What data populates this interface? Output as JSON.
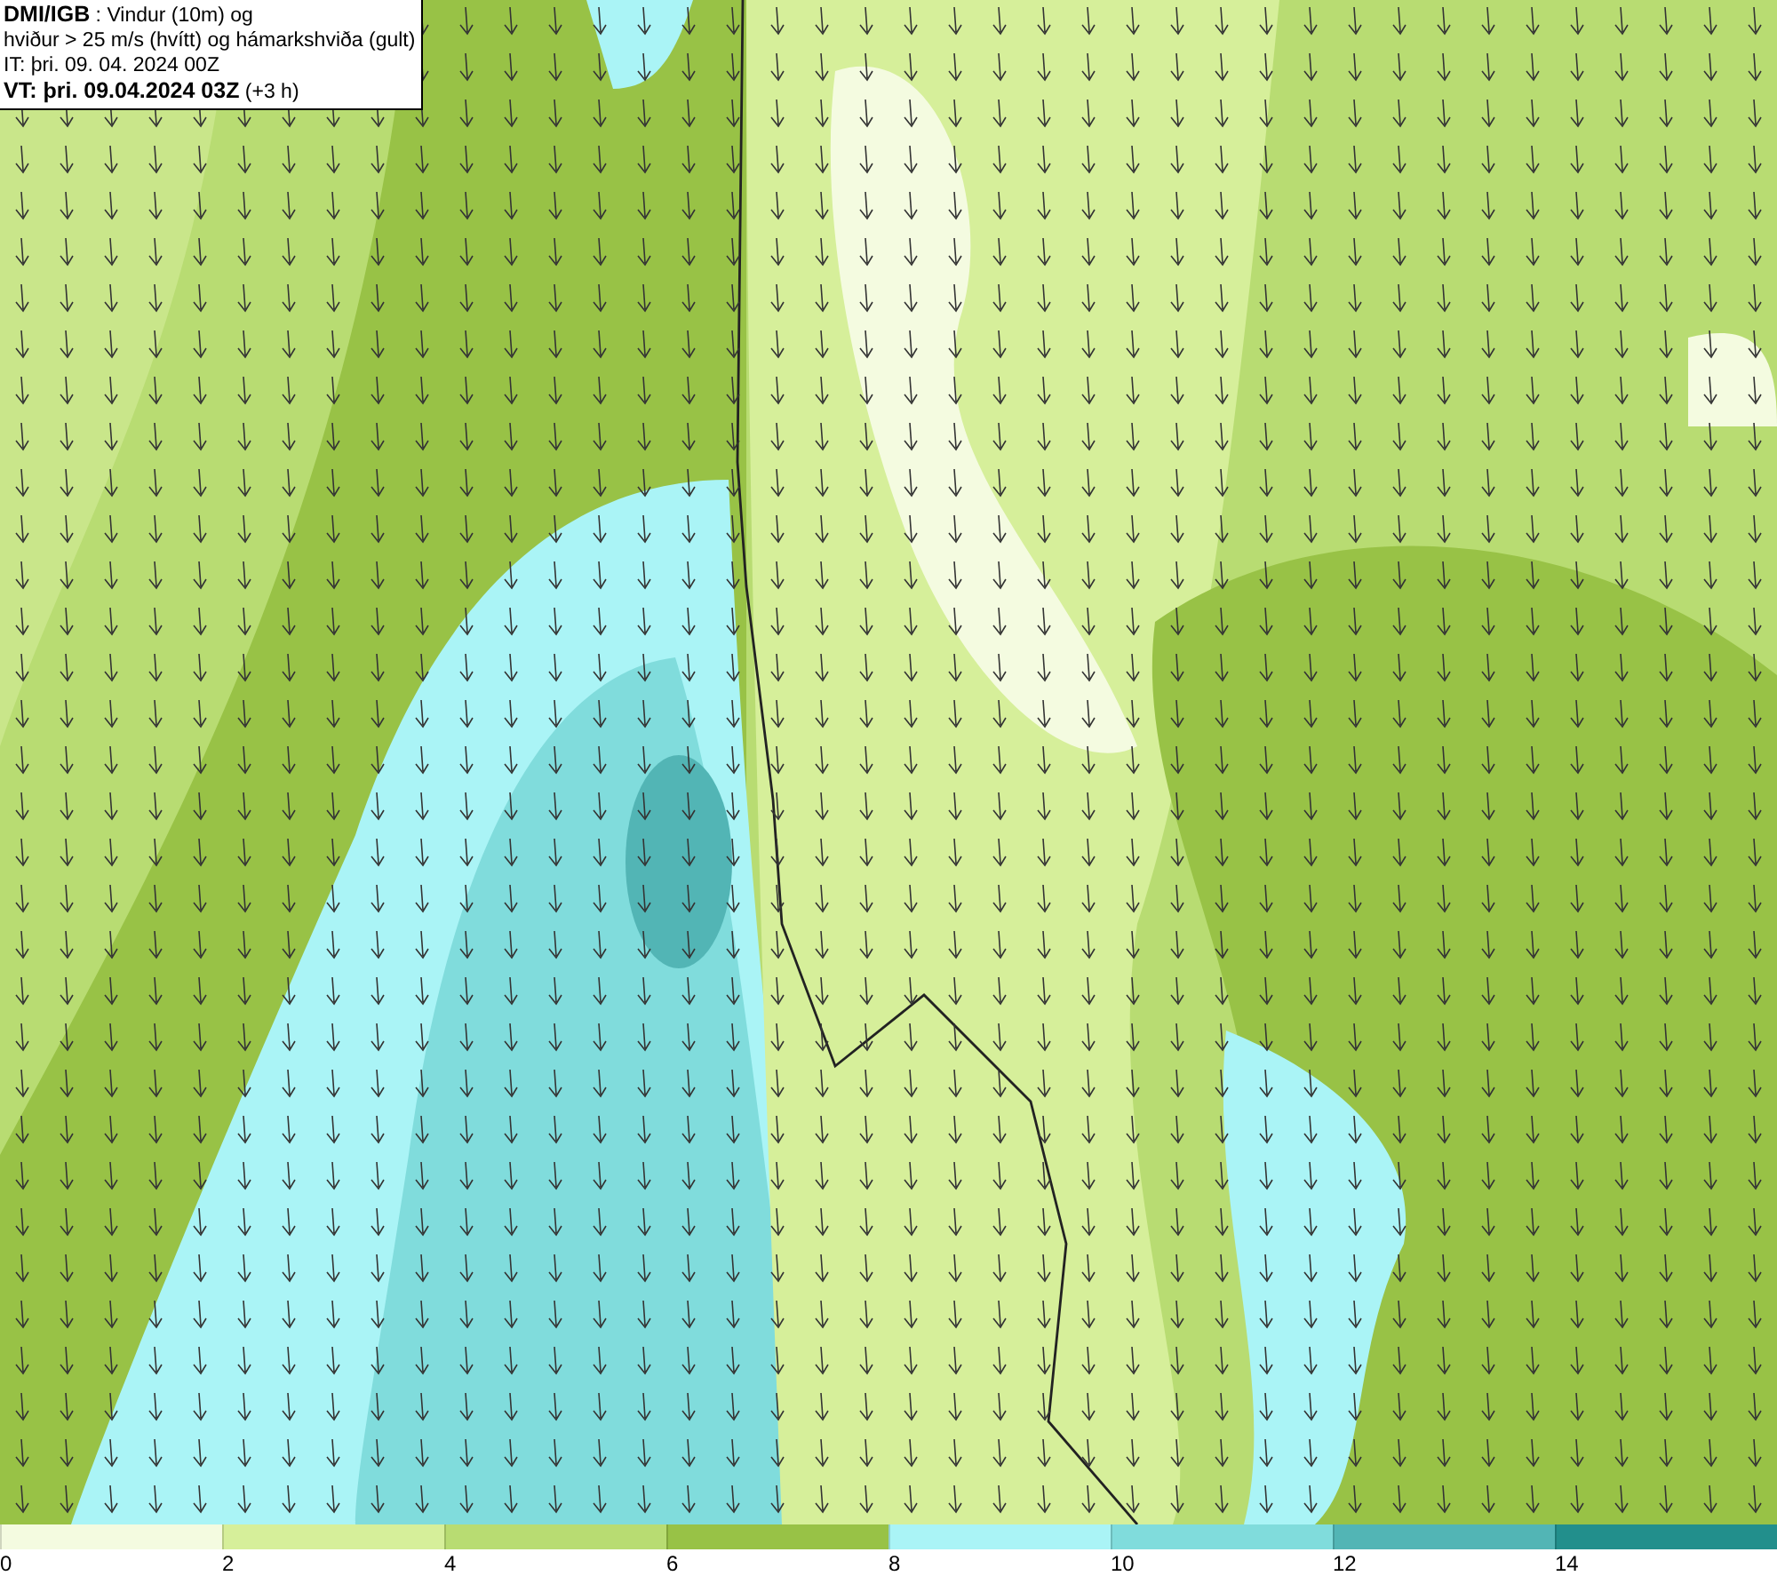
{
  "title_box": {
    "lines": [
      "**DMI/IGB** : Vindur (10m) og",
      "hviður > 25 m/s (hvítt) og hámarkshviða (gult)",
      "IT: þri. 09. 04. 2024 00Z",
      "**VT: þri. 09.04.2024 03Z** (+3 h)"
    ]
  },
  "legend": [
    {
      "label": "0",
      "color": "#f4fbe0"
    },
    {
      "label": "2",
      "color": "#d6ef9a"
    },
    {
      "label": "4",
      "color": "#b8dc72"
    },
    {
      "label": "6",
      "color": "#98c246"
    },
    {
      "label": "8",
      "color": "#aaf4f6"
    },
    {
      "label": "10",
      "color": "#80dcdc"
    },
    {
      "label": "12",
      "color": "#52b5b5"
    },
    {
      "label": "14",
      "color": "#228f8c"
    }
  ]
}
